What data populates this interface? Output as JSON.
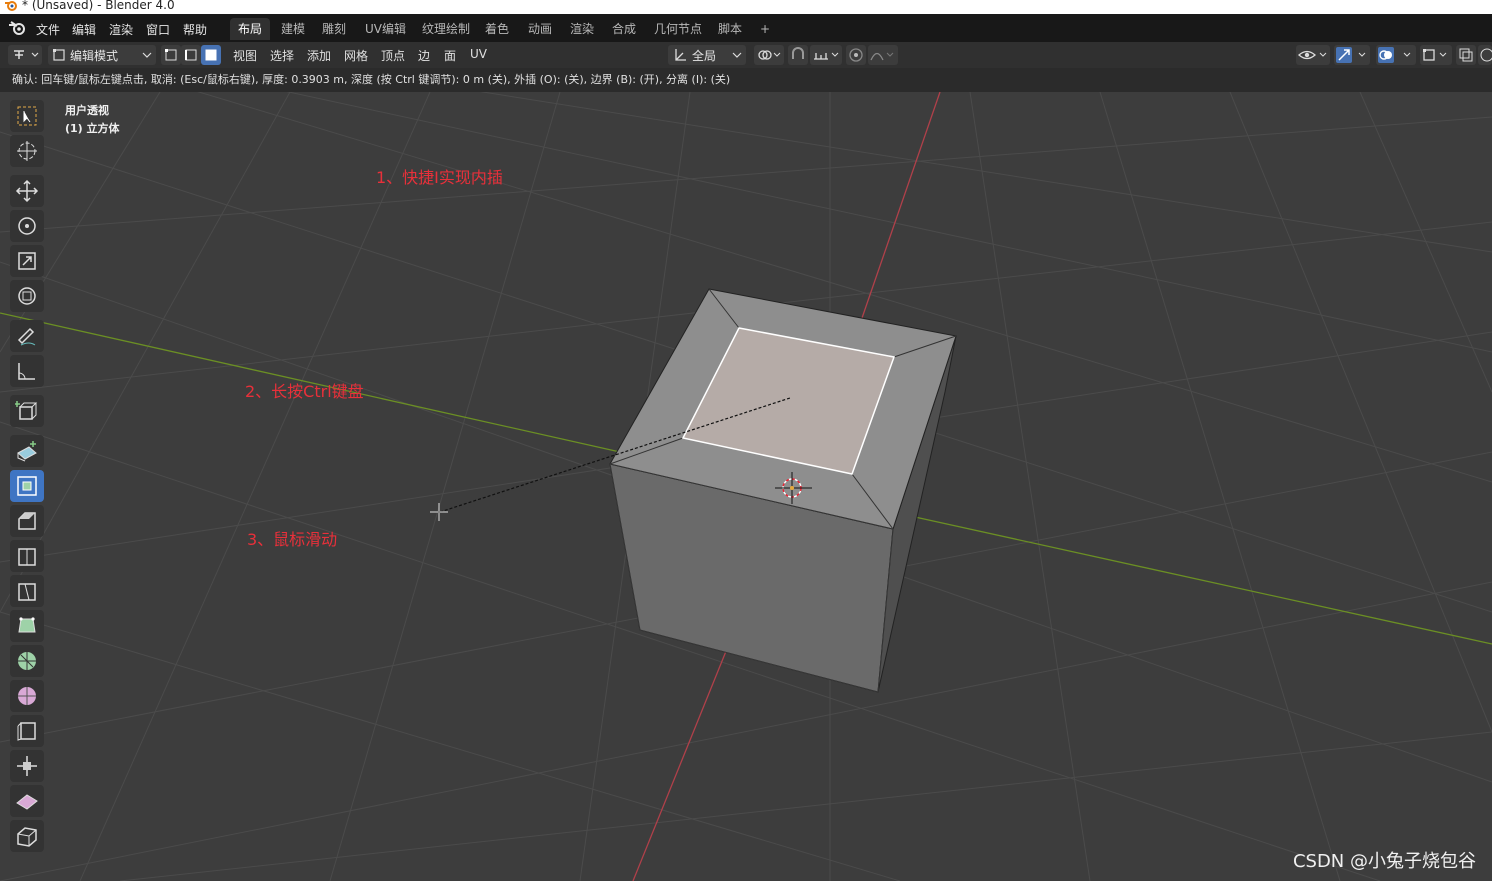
{
  "window": {
    "title": "* (Unsaved) - Blender 4.0"
  },
  "menu": {
    "items": [
      "文件",
      "编辑",
      "渲染",
      "窗口",
      "帮助"
    ]
  },
  "workspaces": {
    "tabs": [
      "布局",
      "建模",
      "雕刻",
      "UV编辑",
      "纹理绘制",
      "着色",
      "动画",
      "渲染",
      "合成",
      "几何节点",
      "脚本"
    ],
    "add": "+"
  },
  "header": {
    "mode": "编辑模式",
    "menus": [
      "视图",
      "选择",
      "添加",
      "网格",
      "顶点",
      "边",
      "面",
      "UV"
    ],
    "orientation": "全局"
  },
  "status": {
    "text": "确认: 回车键/鼠标左键点击, 取消: (Esc/鼠标右键), 厚度: 0.3903 m, 深度 (按 Ctrl 键调节): 0 m (关), 外插 (O): (关), 边界 (B): (开), 分离 (I): (关)"
  },
  "viewport": {
    "view_name": "用户透视",
    "object_name": "(1) 立方体"
  },
  "annotations": [
    "1、快捷I实现内插",
    "2、长按Ctrl键盘",
    "3、鼠标滑动"
  ],
  "watermark": "CSDN @小兔子烧包谷",
  "toolbar_tools": [
    "select-box",
    "cursor",
    "move",
    "rotate",
    "scale",
    "transform",
    "annotate",
    "measure",
    "add-cube",
    "extrude",
    "inset",
    "bevel",
    "loop-cut",
    "knife",
    "poly-build",
    "spin",
    "smooth",
    "edge-slide",
    "shrink-fatten",
    "shear",
    "rip"
  ],
  "active_tool": "inset",
  "colors": {
    "accent": "#3f75c3",
    "annotation": "#e8303a",
    "x_axis": "#c0404a",
    "y_axis": "#6b8f24",
    "selected_face": "#b5aba7"
  }
}
